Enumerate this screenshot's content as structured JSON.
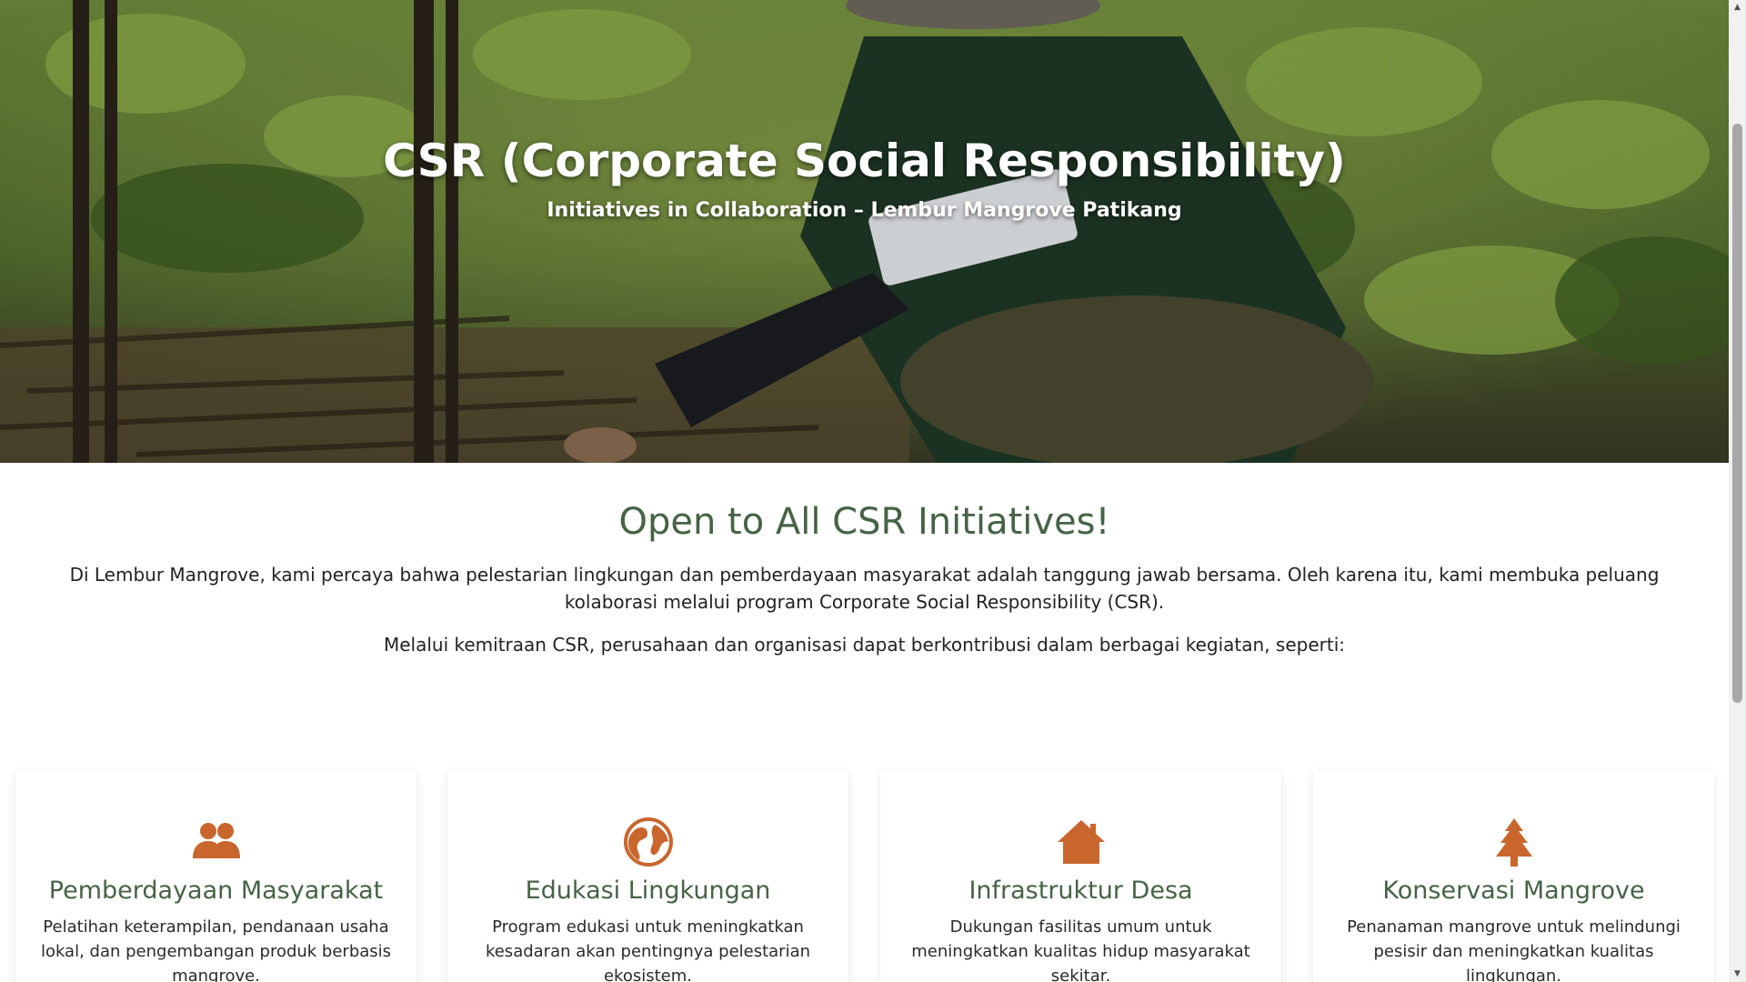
{
  "hero": {
    "title": "CSR (Corporate Social Responsibility)",
    "subtitle": "Initiatives in Collaboration – Lembur Mangrove Patikang"
  },
  "intro": {
    "heading": "Open to All CSR Initiatives!",
    "paragraph1": "Di Lembur Mangrove, kami percaya bahwa pelestarian lingkungan dan pemberdayaan masyarakat adalah tanggung jawab bersama. Oleh karena itu, kami membuka peluang kolaborasi melalui program Corporate Social Responsibility (CSR).",
    "paragraph2": "Melalui kemitraan CSR, perusahaan dan organisasi dapat berkontribusi dalam berbagai kegiatan, seperti:"
  },
  "cards": [
    {
      "icon": "users-icon",
      "title": "Pemberdayaan Masyarakat",
      "text": "Pelatihan keterampilan, pendanaan usaha lokal, dan pengembangan produk berbasis mangrove."
    },
    {
      "icon": "globe-icon",
      "title": "Edukasi Lingkungan",
      "text": "Program edukasi untuk meningkatkan kesadaran akan pentingnya pelestarian ekosistem."
    },
    {
      "icon": "home-icon",
      "title": "Infrastruktur Desa",
      "text": "Dukungan fasilitas umum untuk meningkatkan kualitas hidup masyarakat sekitar."
    },
    {
      "icon": "tree-icon",
      "title": "Konservasi Mangrove",
      "text": "Penanaman mangrove untuk melindungi pesisir dan meningkatkan kualitas lingkungan."
    }
  ],
  "colors": {
    "accent": "#c8662e",
    "heading_green": "#466346"
  }
}
